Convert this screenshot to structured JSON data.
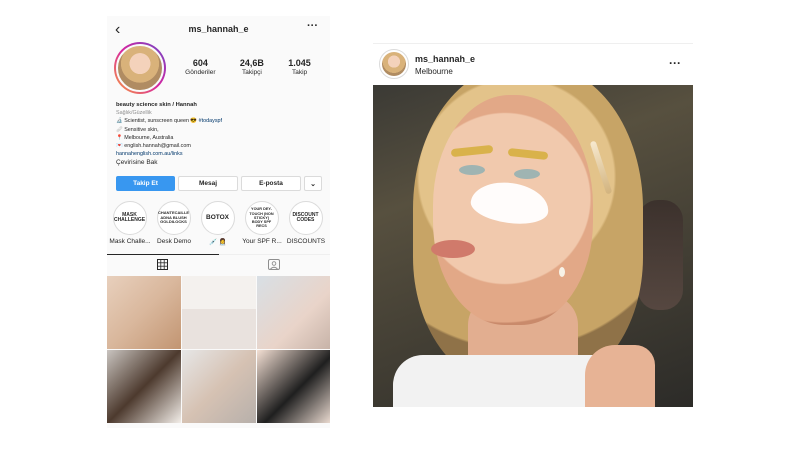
{
  "profile": {
    "back_icon": "chevron-left-icon",
    "username": "ms_hannah_e",
    "more": "···",
    "stats": [
      {
        "value": "604",
        "label": "Gönderiler"
      },
      {
        "value": "24,6B",
        "label": "Takipçi"
      },
      {
        "value": "1.045",
        "label": "Takip"
      }
    ],
    "bio": {
      "name": "beauty science skin / Hannah",
      "category": "Sağlık/Güzellik",
      "line1_text": "🔬 Scientist, sunscreen queen 😎 ",
      "line1_tag": "#todayspf",
      "line2": "🩹 Sensitive skin,",
      "line3": "📍 Melbourne, Australia",
      "line4": "💌 english.hannah@gmail.com",
      "link": "hannahenglish.com.au/links",
      "see_translation": "Çevirisine Bak"
    },
    "buttons": {
      "follow": "Takip Et",
      "message": "Mesaj",
      "email": "E-posta",
      "dropdown": "⌄"
    },
    "highlights": [
      {
        "cover": "MASK CHALLENGE",
        "label": "Mask Challe..."
      },
      {
        "cover": "CHANTECAILLE ADNA BLUSH GOLDILOCKS",
        "label": "Desk Demo"
      },
      {
        "cover": "BOTOX",
        "label": "💉 👩‍⚕️"
      },
      {
        "cover": "YOUR DEY-TOUCH (NON STICKY) BODY SPF RECS",
        "label": "Your SPF R..."
      },
      {
        "cover": "DISCOUNT CODES",
        "label": "DISCOUNTS"
      }
    ],
    "tabs": [
      {
        "icon": "grid-icon"
      },
      {
        "icon": "tagged-icon"
      }
    ]
  },
  "post": {
    "username": "ms_hannah_e",
    "location": "Melbourne",
    "more": "···"
  }
}
